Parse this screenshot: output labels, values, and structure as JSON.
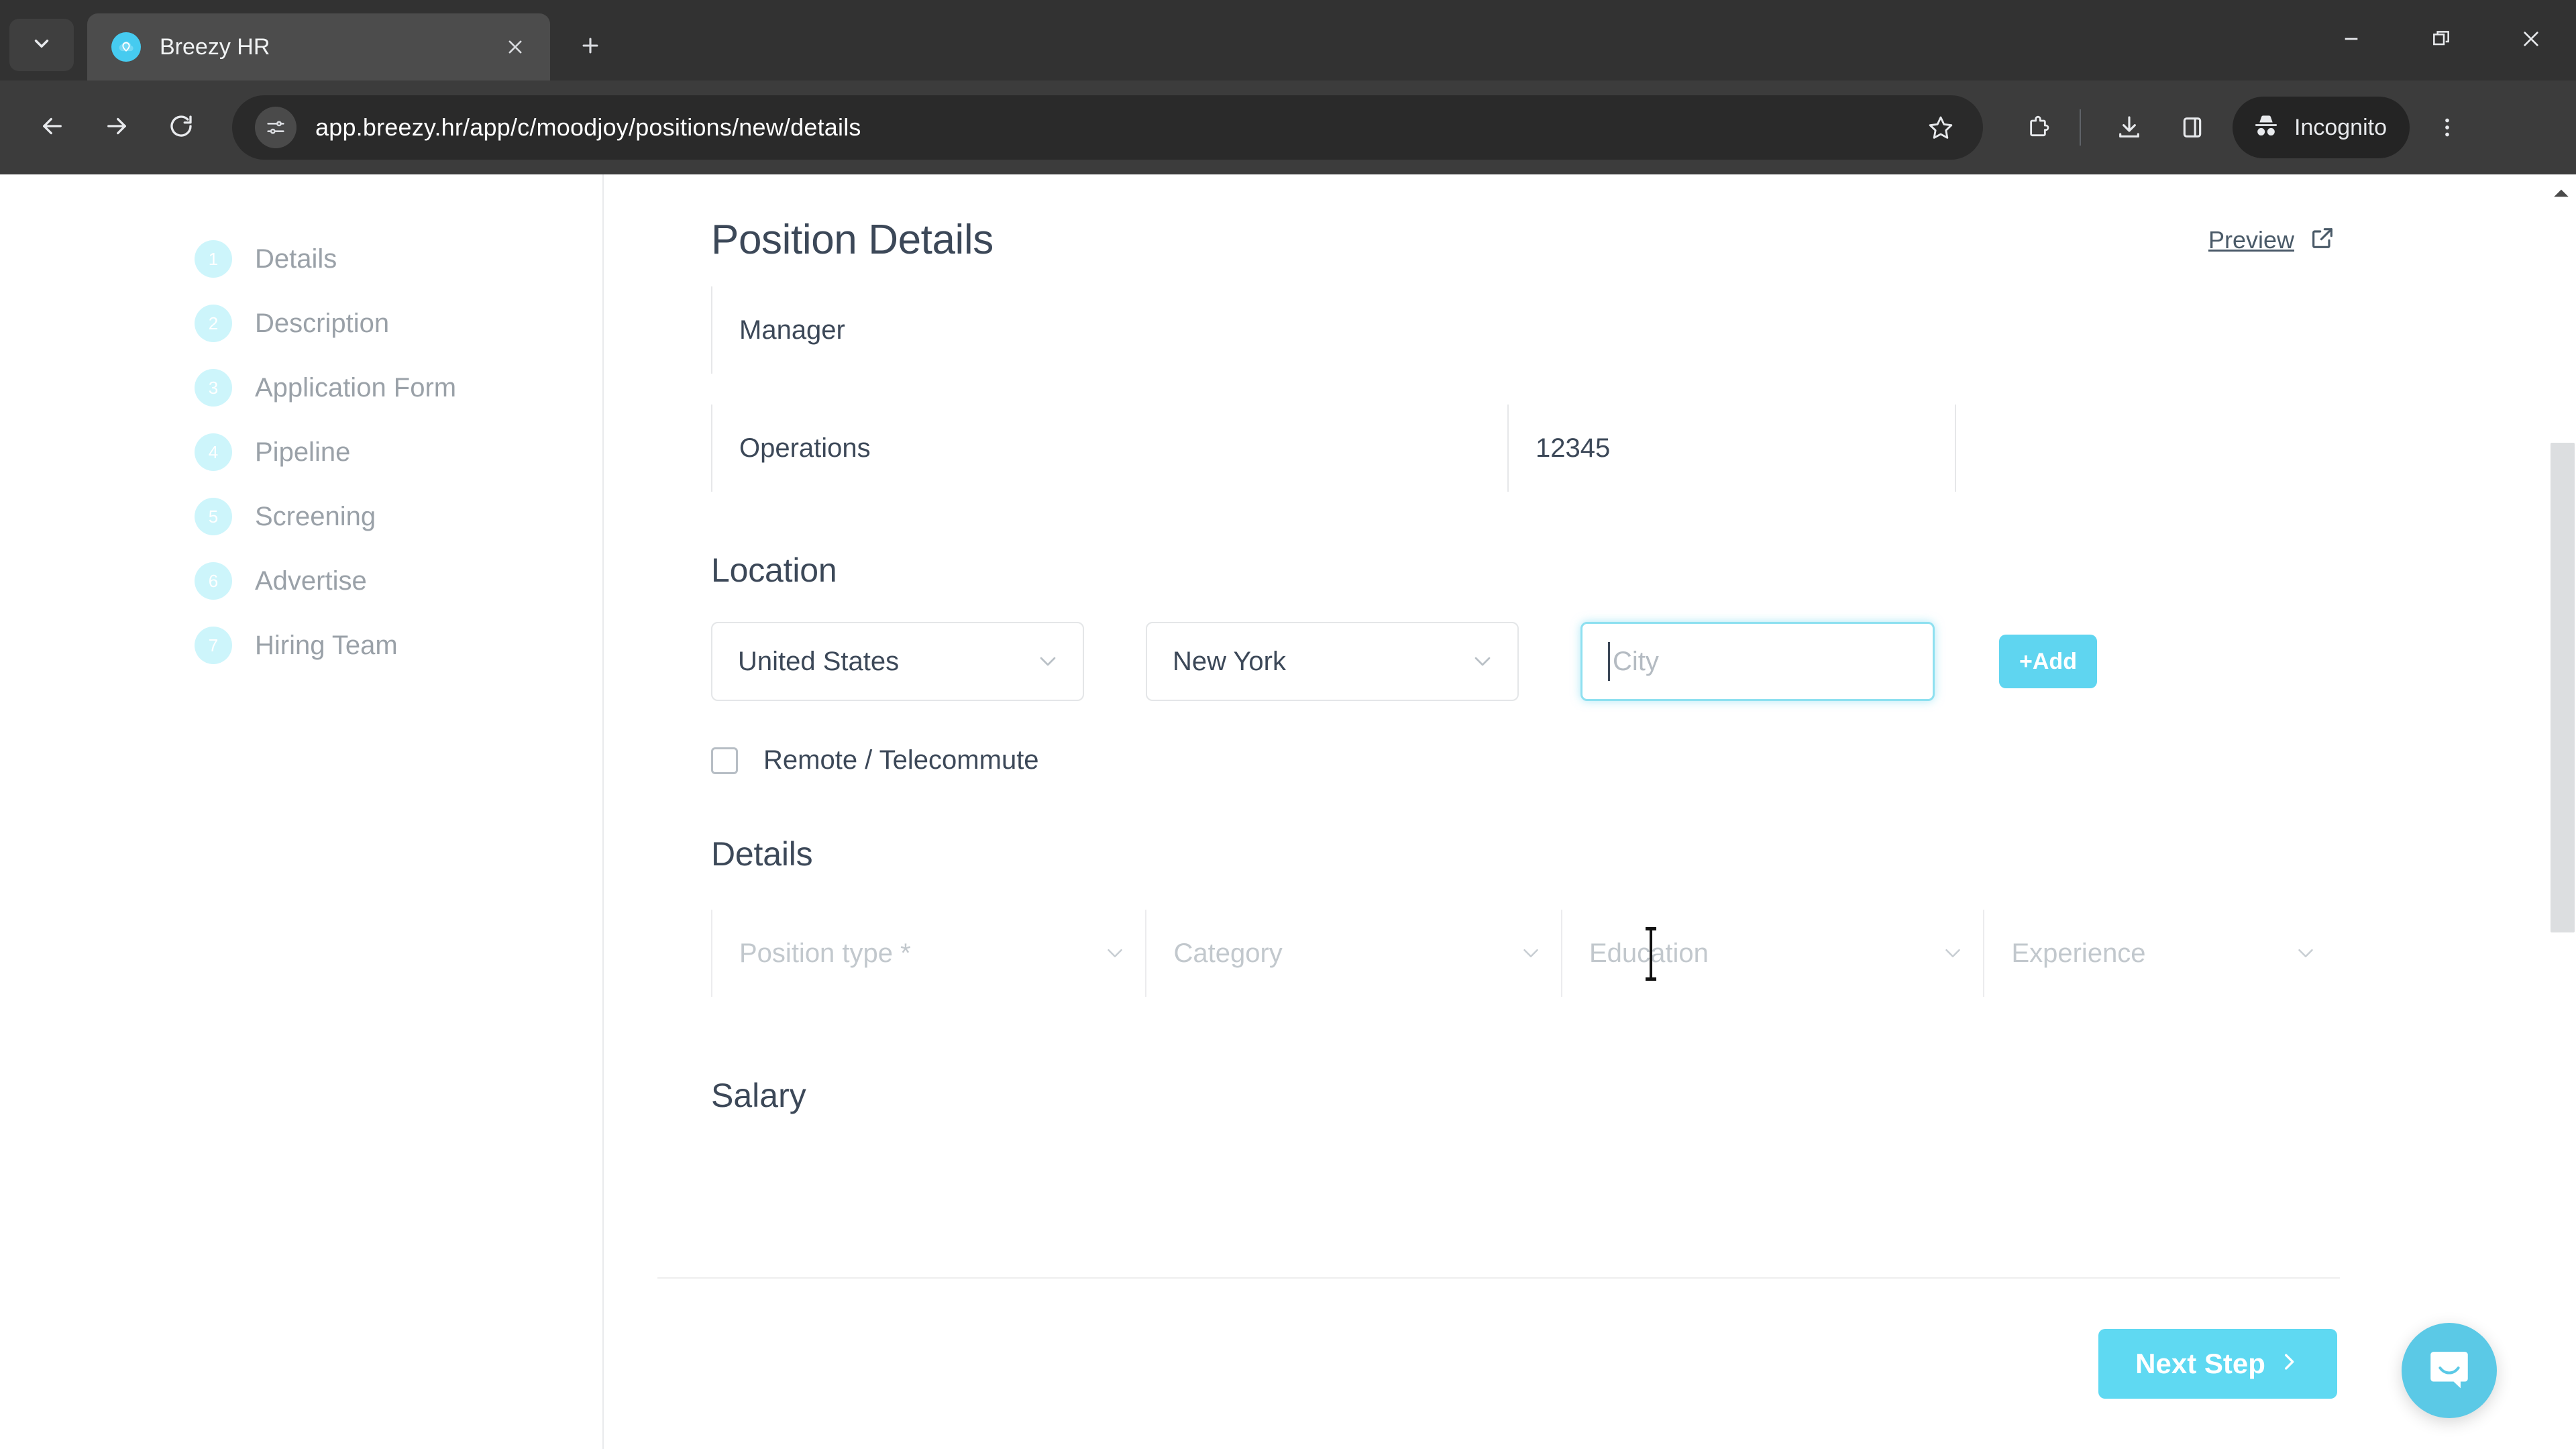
{
  "browser": {
    "tab": {
      "title": "Breezy HR",
      "favicon_icon": "breezy-cloud-icon",
      "close_icon": "close-icon"
    },
    "tab_search_icon": "chevron-down-icon",
    "new_tab_icon": "plus-icon",
    "window_controls": {
      "minimize_icon": "minimize-icon",
      "maximize_icon": "restore-icon",
      "close_icon": "close-icon"
    },
    "toolbar": {
      "back_icon": "arrow-left-icon",
      "forward_icon": "arrow-right-icon",
      "reload_icon": "reload-icon",
      "site_info_icon": "tune-settings-icon",
      "url": "app.breezy.hr/app/c/moodjoy/positions/new/details",
      "bookmark_icon": "star-icon",
      "extensions_icon": "extensions-puzzle-icon",
      "downloads_icon": "download-icon",
      "side_panel_icon": "side-panel-icon",
      "incognito_icon": "incognito-hat-icon",
      "incognito_label": "Incognito",
      "menu_icon": "three-dot-menu-icon"
    }
  },
  "sidebar": {
    "items": [
      {
        "number": "1",
        "label": "Details"
      },
      {
        "number": "2",
        "label": "Description"
      },
      {
        "number": "3",
        "label": "Application Form"
      },
      {
        "number": "4",
        "label": "Pipeline"
      },
      {
        "number": "5",
        "label": "Screening"
      },
      {
        "number": "6",
        "label": "Advertise"
      },
      {
        "number": "7",
        "label": "Hiring Team"
      }
    ]
  },
  "main": {
    "page_title": "Position Details",
    "preview": {
      "label": "Preview",
      "icon": "external-link-icon"
    },
    "position_fields": {
      "title_value": "Manager",
      "department_value": "Operations",
      "code_value": "12345"
    },
    "location": {
      "heading": "Location",
      "country_value": "United States",
      "state_value": "New York",
      "city_placeholder": "City",
      "city_value": "",
      "add_button_label": "+Add",
      "remote_label": "Remote / Telecommute",
      "remote_checked": false,
      "caret_icon": "chevron-down-icon"
    },
    "details": {
      "heading": "Details",
      "selects": [
        {
          "label": "Position type *",
          "icon": "chevron-down-icon"
        },
        {
          "label": "Category",
          "icon": "chevron-down-icon"
        },
        {
          "label": "Education",
          "icon": "chevron-down-icon"
        },
        {
          "label": "Experience",
          "icon": "chevron-down-icon"
        }
      ]
    },
    "salary": {
      "heading": "Salary"
    },
    "footer": {
      "next_label": "Next Step",
      "next_icon": "chevron-right-icon"
    }
  },
  "widgets": {
    "intercom_icon": "intercom-chat-icon",
    "scrollbar_up_icon": "caret-up-icon"
  },
  "colors": {
    "accent": "#5fd9f2",
    "accent_soft": "#cdf5fb",
    "text_dark": "#3c4858",
    "text_muted": "#9aa1a8",
    "chrome_bg": "#3c3c3c",
    "tabstrip_bg": "#323232"
  }
}
